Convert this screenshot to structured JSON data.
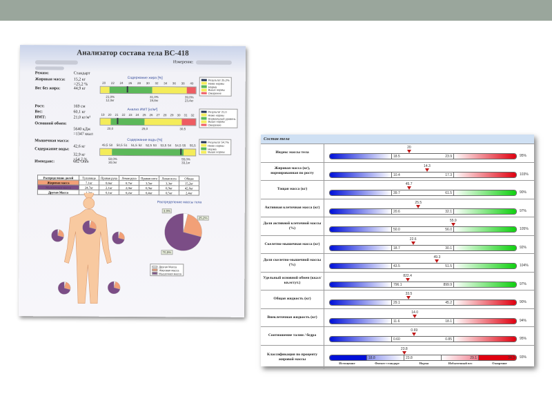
{
  "doc1": {
    "title": "Анализатор состава тела BC-418",
    "measure_label": "Измерение:",
    "stats": [
      {
        "label": "Режим:",
        "value": "Стандарт"
      },
      {
        "label": "Жировая масса:",
        "value": "15,2 кг",
        "value2": "=25,2 %"
      },
      {
        "label": "Вес без жира:",
        "value": "44,9 кг"
      },
      {
        "label": "Рост:",
        "value": "169 см"
      },
      {
        "label": "Вес:",
        "value": "60,1 кг"
      },
      {
        "label": "ИМТ:",
        "value": "21,0 кг/м²"
      },
      {
        "label": "Основной обмен:",
        "value": "5640 кДж",
        "value2": "=1347 ккал"
      },
      {
        "label": "Мышечная масса:",
        "value": "42,6 кг"
      },
      {
        "label": "Содержание воды:",
        "value": "32,9 кг",
        "value2": "=54,7 %"
      },
      {
        "label": "Импеданс:",
        "value": "682 Ohm"
      }
    ],
    "charts": [
      {
        "title": "Содержание жира [%]",
        "range": [
          19,
          41
        ],
        "ticks": [
          "20",
          "22",
          "24",
          "26",
          "28",
          "30",
          "32",
          "34",
          "36",
          "38",
          "40"
        ],
        "tick_start": 20,
        "tick_step": 2,
        "segments": [
          {
            "to": 21,
            "color": "#f4ec5a"
          },
          {
            "to": 31,
            "color": "#5cb85a"
          },
          {
            "to": 39,
            "color": "#f4ec5a"
          },
          {
            "to": 41,
            "color": "#ee5c62"
          }
        ],
        "marker": 25.2,
        "under": [
          {
            "at": 21,
            "text": "21,0%",
            "text2": "12,0кг"
          },
          {
            "at": 31,
            "text": "31,0%",
            "text2": "19,8кг"
          },
          {
            "at": 39,
            "text": "39,0%",
            "text2": "23,4кг"
          }
        ],
        "legend": [
          "Результат 25,2%",
          "Ниже нормы",
          "Норма",
          "Выше нормы",
          "Ожирение"
        ]
      },
      {
        "title": "Анализ ИМТ [кг/м²]",
        "range": [
          18.5,
          32.5
        ],
        "ticks": [
          "19",
          "20",
          "21",
          "22",
          "23",
          "24",
          "25",
          "26",
          "27",
          "28",
          "29",
          "30",
          "31",
          "32"
        ],
        "tick_start": 19,
        "tick_step": 1,
        "segments": [
          {
            "to": 20,
            "color": "#f4ec5a"
          },
          {
            "to": 25,
            "color": "#5cb85a"
          },
          {
            "to": 30.5,
            "color": "#f4ec5a"
          },
          {
            "to": 32.5,
            "color": "#ee5c62"
          }
        ],
        "marker": 21.0,
        "under": [
          {
            "at": 20,
            "text": "20,0"
          },
          {
            "at": 25,
            "text": "25,0"
          },
          {
            "at": 30.5,
            "text": "30,5"
          }
        ],
        "legend": [
          "Результат 21,0",
          "Ниже нормы",
          "Нормальный уровень",
          "Выше нормы",
          "Ожирение"
        ]
      },
      {
        "title": "Содержание воды [%]",
        "range": [
          49.2,
          55.8
        ],
        "ticks": [
          "49,5",
          "50",
          "50,5",
          "51",
          "51,5",
          "52",
          "52,5",
          "53",
          "53,5",
          "54",
          "54,5",
          "55",
          "55,5"
        ],
        "tick_start": 49.5,
        "tick_step": 0.5,
        "segments": [
          {
            "to": 50,
            "color": "#f4ec5a"
          },
          {
            "to": 55,
            "color": "#5cb85a"
          },
          {
            "to": 55.8,
            "color": "#f4ec5a"
          }
        ],
        "marker": 54.7,
        "under": [
          {
            "at": 50,
            "text": "50,0%",
            "text2": "30,0кг"
          },
          {
            "at": 55,
            "text": "55,0%",
            "text2": "33,1кг"
          }
        ],
        "legend": [
          "Результат 54,7%",
          "Ниже нормы",
          "Норма",
          "Выше нормы"
        ]
      }
    ],
    "table": {
      "headers": [
        "Распределение долей",
        "Туловище",
        "Правая рука",
        "Левая рука",
        "Правая нога",
        "Левая нога",
        "Общее"
      ],
      "rows": [
        {
          "name": "Жировая масса",
          "color": "#f2a077",
          "cells": [
            "7,1кг",
            "0,6кг",
            "0,7кг",
            "3,5кг",
            "3,3кг",
            "15,2кг"
          ]
        },
        {
          "name": "Мышечная масса",
          "color": "#7b4d86",
          "cells": [
            "24,7кг",
            "2,1кг",
            "2,0кг",
            "6,9кг",
            "6,9кг",
            "42,6кг"
          ]
        },
        {
          "name": "Другая Масса",
          "color": "#ffffff",
          "cells": [
            "1,2кг",
            "0,1кг",
            "0,2кг",
            "0,4кг",
            "0,5кг",
            "2,4кг"
          ]
        }
      ]
    },
    "pie": {
      "title": "Распределение массы тела",
      "slices": [
        {
          "label": "Другая Масса",
          "value": 3.9,
          "text": "3,9%",
          "color": "#ffffff"
        },
        {
          "label": "Жировая масса",
          "value": 25.2,
          "text": "25,2%",
          "color": "#f2a077"
        },
        {
          "label": "Мышечная масса",
          "value": 70.9,
          "text": "70,9%",
          "color": "#7b4d86"
        }
      ]
    }
  },
  "doc2": {
    "header": "Состав тела",
    "rows": [
      {
        "name": "Индекс массы тела",
        "value": "20",
        "lo": 18.5,
        "hi": 23.9,
        "v": 20,
        "lo_text": "18.5",
        "hi_text": "23.9",
        "right": "red",
        "pct": "95%"
      },
      {
        "name": "Жировая масса (кг), нормированная по росту",
        "value": "14.3",
        "lo": 10.4,
        "hi": 17.3,
        "v": 14.3,
        "lo_text": "10.4",
        "hi_text": "17.3",
        "right": "red",
        "pct": "103%"
      },
      {
        "name": "Тощая масса (кг)",
        "value": "45.7",
        "lo": 39.7,
        "hi": 61.5,
        "v": 45.7,
        "lo_text": "39.7",
        "hi_text": "61.5",
        "right": "green",
        "pct": "90%"
      },
      {
        "name": "Активная клеточная масса (кг)",
        "value": "25.5",
        "lo": 20.6,
        "hi": 32.1,
        "v": 25.5,
        "lo_text": "20.6",
        "hi_text": "32.1",
        "right": "green",
        "pct": "97%"
      },
      {
        "name": "Доля активной клеточной массы (%)",
        "value": "55.9",
        "lo": 50.0,
        "hi": 56.0,
        "v": 55.9,
        "lo_text": "50.0",
        "hi_text": "56.0",
        "right": "green",
        "pct": "105%"
      },
      {
        "name": "Скелетно-мышечная масса (кг)",
        "value": "22.6",
        "lo": 18.7,
        "hi": 30.1,
        "v": 22.6,
        "lo_text": "18.7",
        "hi_text": "30.1",
        "right": "green",
        "pct": "92%"
      },
      {
        "name": "Доля скелетно-мышечной массы (%)",
        "value": "49.3",
        "lo": 43.5,
        "hi": 51.5,
        "v": 49.3,
        "lo_text": "43.5",
        "hi_text": "51.5",
        "right": "green",
        "pct": "104%"
      },
      {
        "name": "Удельный основной обмен (ккал/кв.м/сут.)",
        "value": "822.4",
        "lo": 796.1,
        "hi": 899.9,
        "v": 822.4,
        "lo_text": "796.1",
        "hi_text": "899.9",
        "right": "green",
        "pct": "97%"
      },
      {
        "name": "Общая жидкость (кг)",
        "value": "33.5",
        "lo": 29.1,
        "hi": 45.2,
        "v": 33.5,
        "lo_text": "29.1",
        "hi_text": "45.2",
        "right": "red",
        "pct": "90%"
      },
      {
        "name": "Внеклеточная жидкость (кг)",
        "value": "14.0",
        "lo": 11.6,
        "hi": 18.1,
        "v": 14.0,
        "lo_text": "11.6",
        "hi_text": "18.1",
        "right": "red",
        "pct": "94%"
      },
      {
        "name": "Соотношение талии / бедра",
        "value": "0.69",
        "lo": 0.6,
        "hi": 0.85,
        "v": 0.69,
        "lo_text": "0.60",
        "hi_text": "0.85",
        "right": "red",
        "pct": "95%"
      }
    ],
    "last": {
      "name": "Классификация по проценту жировой массы",
      "value": "23.8",
      "v": 23.8,
      "bounds": [
        "18.8",
        "23.8",
        "29.1",
        "34.3"
      ],
      "pct": "93%",
      "categories": [
        "Истощение",
        "Фитнес-стандарт",
        "Норма",
        "Избыточный вес",
        "Ожирение"
      ]
    }
  }
}
